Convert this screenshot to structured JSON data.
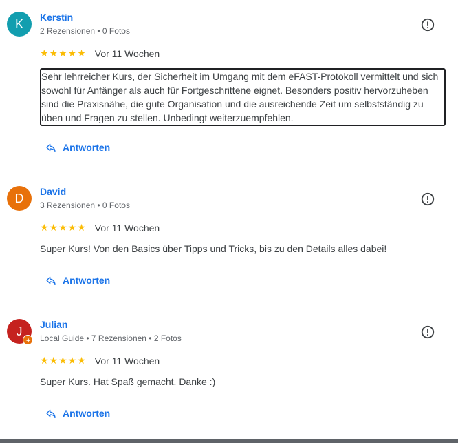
{
  "colors": {
    "accent": "#1a73e8",
    "star": "#fbbc04",
    "avatar_k": "#129eaf",
    "avatar_d": "#e8710a",
    "avatar_j": "#c5221f"
  },
  "reviews": [
    {
      "initial": "K",
      "name": "Kerstin",
      "meta": "2 Rezensionen • 0 Fotos",
      "stars": "★★★★★",
      "date": "Vor 11 Wochen",
      "text": "Sehr lehrreicher Kurs, der Sicherheit im Umgang mit dem eFAST-Protokoll vermittelt und sich sowohl für Anfänger als auch für Fortgeschrittene eignet. Besonders positiv hervorzuheben sind die Praxisnähe, die gute Organisation und die ausreichende Zeit um selbstständig zu üben und Fragen zu stellen. Unbedingt weiterzuempfehlen.",
      "reply_label": "Antworten"
    },
    {
      "initial": "D",
      "name": "David",
      "meta": "3 Rezensionen • 0 Fotos",
      "stars": "★★★★★",
      "date": "Vor 11 Wochen",
      "text": "Super Kurs! Von den Basics über Tipps und Tricks, bis zu den Details alles dabei!",
      "reply_label": "Antworten"
    },
    {
      "initial": "J",
      "name": "Julian",
      "meta": "Local Guide • 7 Rezensionen • 2 Fotos",
      "stars": "★★★★★",
      "date": "Vor 11 Wochen",
      "text": "Super Kurs. Hat Spaß gemacht. Danke :)",
      "reply_label": "Antworten"
    }
  ]
}
